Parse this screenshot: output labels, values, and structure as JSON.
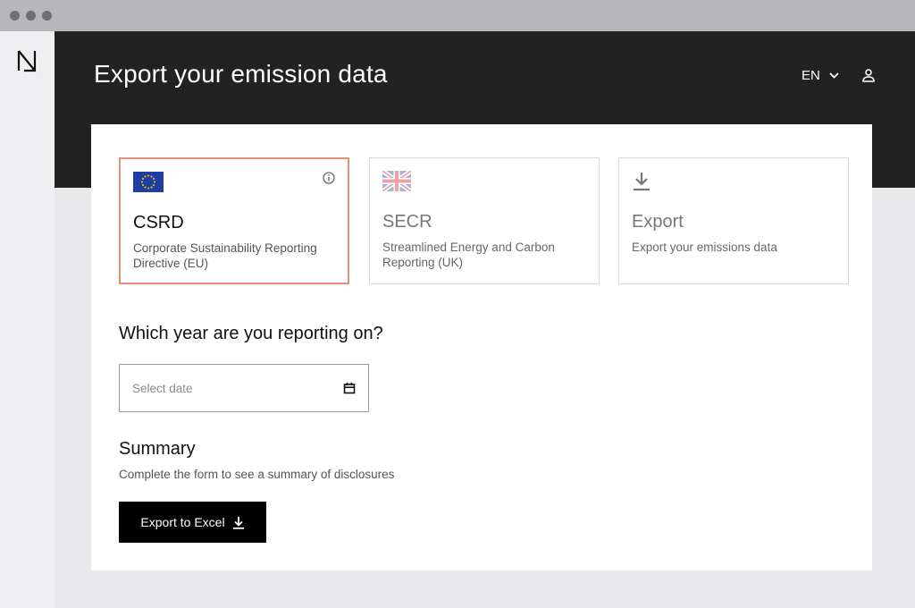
{
  "app": {
    "title": "Export your emission data",
    "language": "EN"
  },
  "header_icons": {
    "logo": "logo-icon",
    "language_chevron": "chevron-down-icon",
    "user": "user-icon"
  },
  "cards": [
    {
      "title": "CSRD",
      "description": "Corporate Sustainability Reporting Directive (EU)",
      "icon": "eu-flag-icon",
      "selected": true
    },
    {
      "title": "SECR",
      "description": "Streamlined Energy and Carbon Reporting (UK)",
      "icon": "uk-flag-icon",
      "selected": false
    },
    {
      "title": "Export",
      "description": "Export your emissions data",
      "icon": "download-icon",
      "selected": false
    }
  ],
  "year": {
    "question": "Which year are you reporting on?",
    "placeholder": "Select date",
    "icon": "calendar-icon"
  },
  "summary": {
    "title": "Summary",
    "description": "Complete the form to see a summary of disclosures"
  },
  "export_button": {
    "label": "Export to Excel",
    "icon": "download-icon"
  },
  "colors": {
    "header": "#222222",
    "selected_border": "#ee8c76",
    "background": "#e9e9ec",
    "button": "#000000"
  }
}
